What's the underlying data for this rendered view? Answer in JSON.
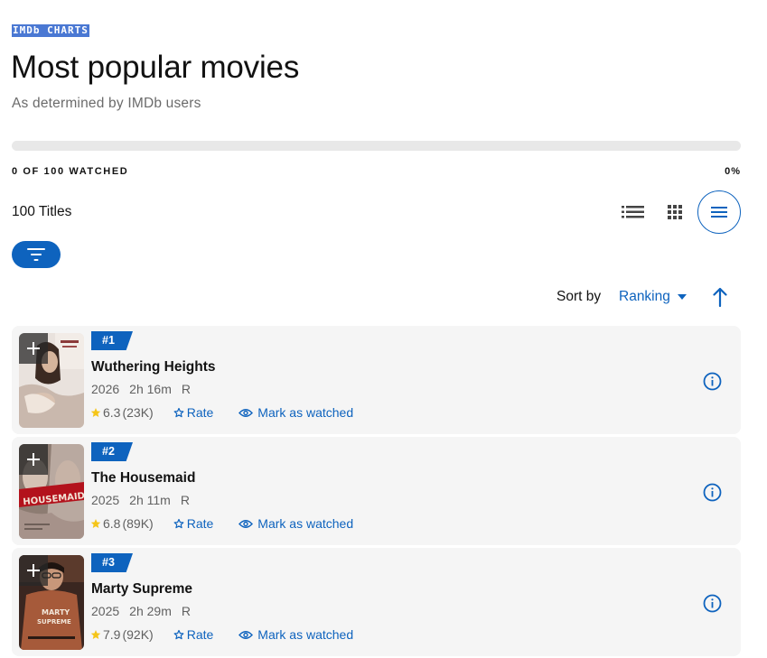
{
  "header": {
    "eyebrow": "IMDb CHARTS",
    "title": "Most popular movies",
    "subtitle": "As determined by IMDb users"
  },
  "progress": {
    "label": "0 OF 100 WATCHED",
    "percent_text": "0%",
    "fraction": 0
  },
  "toolbar": {
    "titles_count": "100 Titles",
    "views": [
      "list-view-icon",
      "grid-view-icon",
      "compact-view-icon"
    ],
    "selected_view": "compact-view-icon",
    "filter_icon": "filter-icon"
  },
  "sort": {
    "label": "Sort by",
    "value": "Ranking",
    "direction_icon": "arrow-up-icon"
  },
  "colors": {
    "accent": "#0e63be",
    "eyebrow_bg": "#4a78d3",
    "star": "#f5c518",
    "card_bg": "#f5f5f5"
  },
  "movies": [
    {
      "rank": "#1",
      "title": "Wuthering Heights",
      "year": "2026",
      "runtime": "2h 16m",
      "certificate": "R",
      "rating": "6.3",
      "votes": "(23K)",
      "rate_label": "Rate",
      "watched_label": "Mark as watched"
    },
    {
      "rank": "#2",
      "title": "The Housemaid",
      "year": "2025",
      "runtime": "2h 11m",
      "certificate": "R",
      "rating": "6.8",
      "votes": "(89K)",
      "rate_label": "Rate",
      "watched_label": "Mark as watched"
    },
    {
      "rank": "#3",
      "title": "Marty Supreme",
      "year": "2025",
      "runtime": "2h 29m",
      "certificate": "R",
      "rating": "7.9",
      "votes": "(92K)",
      "rate_label": "Rate",
      "watched_label": "Mark as watched"
    }
  ]
}
